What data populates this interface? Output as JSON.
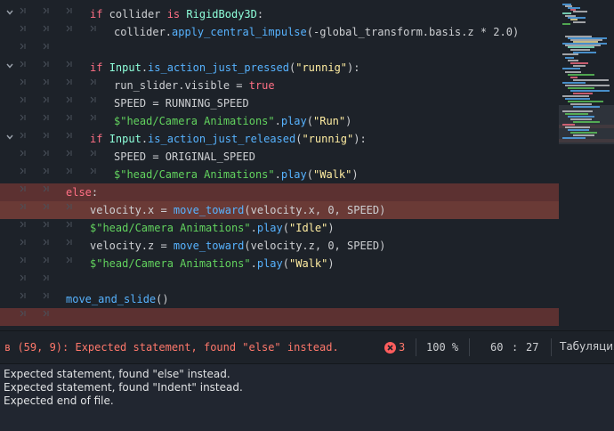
{
  "editor": {
    "lines": [
      {
        "tokens": [
          {
            "t": "if",
            "c": "kw"
          },
          {
            "t": " collider ",
            "c": "plain"
          },
          {
            "t": "is",
            "c": "kw"
          },
          {
            "t": " ",
            "c": "plain"
          },
          {
            "t": "RigidBody3D",
            "c": "cls"
          },
          {
            "t": ":",
            "c": "plain"
          }
        ]
      },
      {
        "tokens": [
          {
            "t": "collider.",
            "c": "plain"
          },
          {
            "t": "apply_central_impulse",
            "c": "fn"
          },
          {
            "t": "(-global_transform.basis.z * 2.0)",
            "c": "plain"
          }
        ]
      },
      {
        "tokens": []
      },
      {
        "tokens": [
          {
            "t": "if",
            "c": "kw"
          },
          {
            "t": " ",
            "c": "plain"
          },
          {
            "t": "Input",
            "c": "cls"
          },
          {
            "t": ".",
            "c": "plain"
          },
          {
            "t": "is_action_just_pressed",
            "c": "fn"
          },
          {
            "t": "(",
            "c": "plain"
          },
          {
            "t": "\"runnig\"",
            "c": "str"
          },
          {
            "t": "):",
            "c": "plain"
          }
        ]
      },
      {
        "tokens": [
          {
            "t": "run_slider.visible = ",
            "c": "plain"
          },
          {
            "t": "true",
            "c": "lit"
          }
        ]
      },
      {
        "tokens": [
          {
            "t": "SPEED = RUNNING_SPEED",
            "c": "plain"
          }
        ]
      },
      {
        "tokens": [
          {
            "t": "$\"head/Camera Animations\"",
            "c": "nstr"
          },
          {
            "t": ".",
            "c": "plain"
          },
          {
            "t": "play",
            "c": "fn"
          },
          {
            "t": "(",
            "c": "plain"
          },
          {
            "t": "\"Run\"",
            "c": "str"
          },
          {
            "t": ")",
            "c": "plain"
          }
        ]
      },
      {
        "tokens": [
          {
            "t": "if",
            "c": "kw"
          },
          {
            "t": " ",
            "c": "plain"
          },
          {
            "t": "Input",
            "c": "cls"
          },
          {
            "t": ".",
            "c": "plain"
          },
          {
            "t": "is_action_just_released",
            "c": "fn"
          },
          {
            "t": "(",
            "c": "plain"
          },
          {
            "t": "\"runnig\"",
            "c": "str"
          },
          {
            "t": "):",
            "c": "plain"
          }
        ]
      },
      {
        "tokens": [
          {
            "t": "SPEED = ORIGINAL_SPEED",
            "c": "plain"
          }
        ]
      },
      {
        "tokens": [
          {
            "t": "$\"head/Camera Animations\"",
            "c": "nstr"
          },
          {
            "t": ".",
            "c": "plain"
          },
          {
            "t": "play",
            "c": "fn"
          },
          {
            "t": "(",
            "c": "plain"
          },
          {
            "t": "\"Walk\"",
            "c": "str"
          },
          {
            "t": ")",
            "c": "plain"
          }
        ]
      },
      {
        "tokens": [
          {
            "t": "else",
            "c": "kw"
          },
          {
            "t": ":",
            "c": "plain"
          }
        ]
      },
      {
        "tokens": [
          {
            "t": "velocity.x = ",
            "c": "plain"
          },
          {
            "t": "move_toward",
            "c": "fn"
          },
          {
            "t": "(velocity.x, 0, SPEED)",
            "c": "plain"
          }
        ]
      },
      {
        "tokens": [
          {
            "t": "$\"head/Camera Animations\"",
            "c": "nstr"
          },
          {
            "t": ".",
            "c": "plain"
          },
          {
            "t": "play",
            "c": "fn"
          },
          {
            "t": "(",
            "c": "plain"
          },
          {
            "t": "\"Idle\"",
            "c": "str"
          },
          {
            "t": ")",
            "c": "plain"
          }
        ]
      },
      {
        "tokens": [
          {
            "t": "velocity.z = ",
            "c": "plain"
          },
          {
            "t": "move_toward",
            "c": "fn"
          },
          {
            "t": "(velocity.z, 0, SPEED)",
            "c": "plain"
          }
        ]
      },
      {
        "tokens": [
          {
            "t": "$\"head/Camera Animations\"",
            "c": "nstr"
          },
          {
            "t": ".",
            "c": "plain"
          },
          {
            "t": "play",
            "c": "fn"
          },
          {
            "t": "(",
            "c": "plain"
          },
          {
            "t": "\"Walk\"",
            "c": "str"
          },
          {
            "t": ")",
            "c": "plain"
          }
        ]
      },
      {
        "tokens": []
      },
      {
        "tokens": [
          {
            "t": "move_and_slide",
            "c": "fn"
          },
          {
            "t": "()",
            "c": "plain"
          }
        ]
      },
      {
        "tokens": []
      }
    ]
  },
  "status": {
    "error_message": "в (59, 9): Expected statement, found \"else\" instead.",
    "error_count": "3",
    "zoom": "100 %",
    "cursor_line": "60",
    "cursor_sep": ":",
    "cursor_col": "27",
    "indent_mode": "Табуляция"
  },
  "output": {
    "messages": [
      "Expected statement, found \"else\" instead.",
      "Expected statement, found \"Indent\" instead.",
      "Expected end of file."
    ]
  },
  "icons": {
    "fold": "chevron-down-icon",
    "tab_guide": "tab-arrow-icon",
    "error": "error-circle-icon"
  },
  "colors": {
    "background": "#1d2229",
    "error_line": "#5c3131",
    "keyword": "#ff7085",
    "function": "#57b3ff",
    "string": "#ffeda1",
    "class": "#8effda",
    "node_path": "#62d35e",
    "error_text": "#ff786b"
  }
}
